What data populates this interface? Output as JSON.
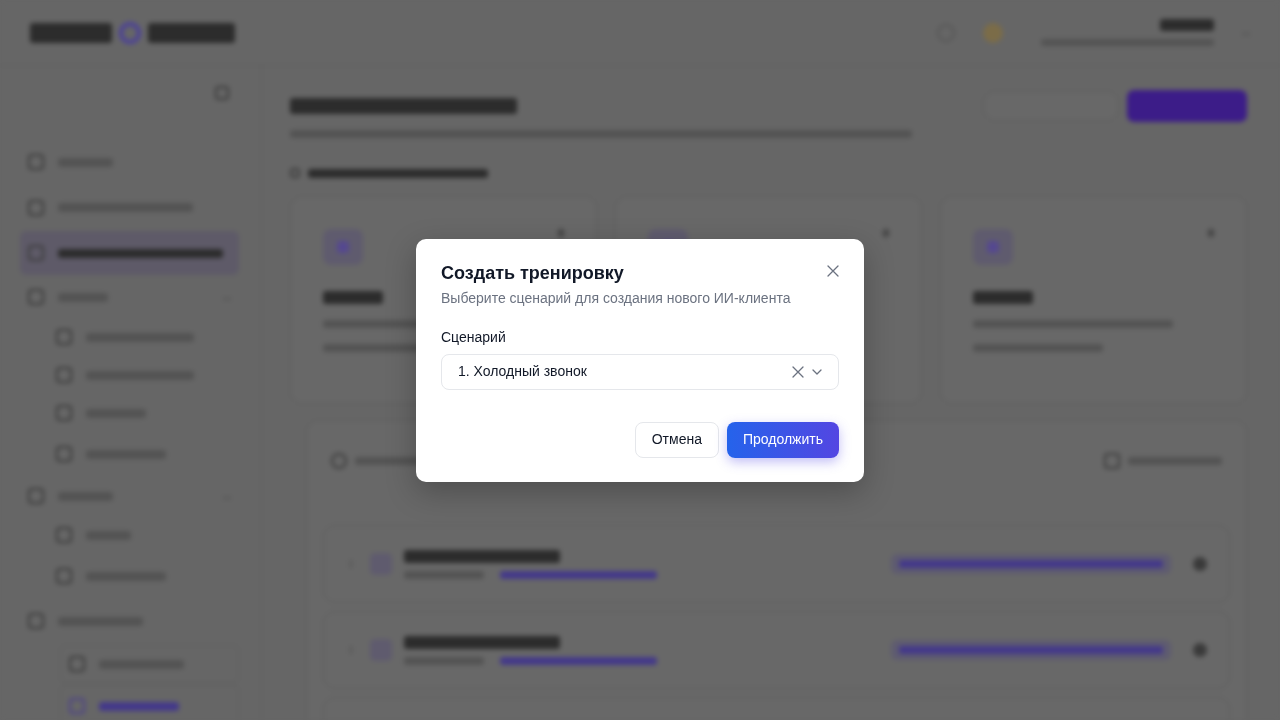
{
  "dialog": {
    "title": "Создать тренировку",
    "subtitle": "Выберите сценарий для создания нового ИИ-клиента",
    "field": {
      "label": "Сценарий",
      "value": "1. Холодный звонок"
    },
    "buttons": [
      {
        "label": "Отмена",
        "kind": "secondary"
      },
      {
        "label": "Продолжить",
        "kind": "primary"
      }
    ]
  }
}
